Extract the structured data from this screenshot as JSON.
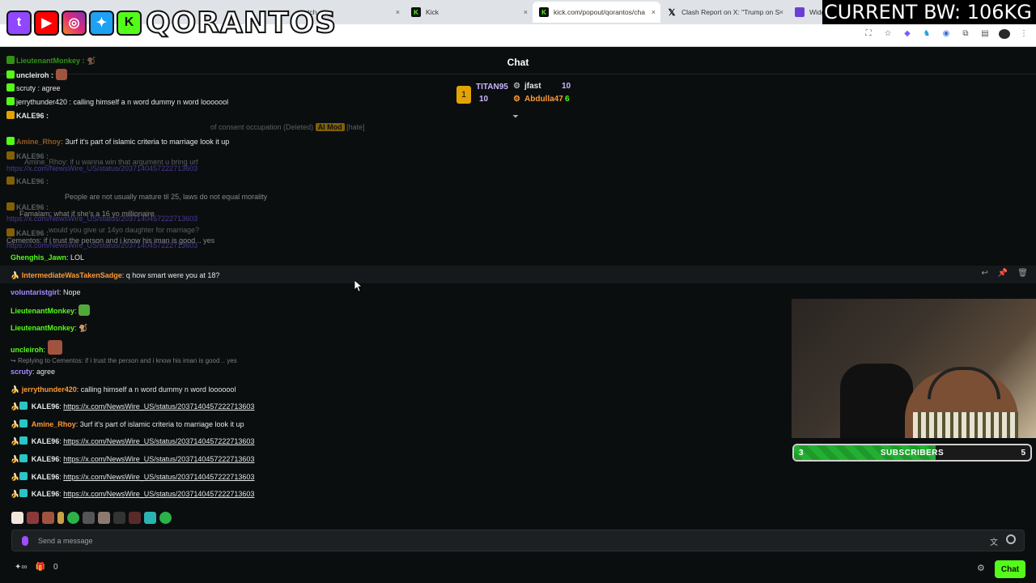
{
  "browser": {
    "tabs": [
      {
        "label": "tch",
        "icon": "generic",
        "active": false
      },
      {
        "label": "Kick",
        "icon": "kick",
        "active": false
      },
      {
        "label": "kick.com/popout/qorantos/cha",
        "icon": "kick",
        "active": true
      },
      {
        "label": "Clash Report on X: \"Trump on S",
        "icon": "x",
        "active": false
      },
      {
        "label": "Widg",
        "icon": "generic",
        "active": false
      }
    ],
    "close_glyph": "×"
  },
  "overlay": {
    "logo_text": "QORANTOS",
    "socials": [
      "twitch",
      "youtube",
      "instagram",
      "twitter",
      "kick"
    ],
    "bodyweight": "CURRENT BW: 106KG"
  },
  "chat": {
    "title": "Chat",
    "leaderboard": [
      {
        "name": "TITAN95",
        "count": "10",
        "color": "#c9b8ff"
      },
      {
        "name": "jfast",
        "count": "10",
        "color": "#e6e6e6"
      },
      {
        "name": "Abdulla47",
        "count": "6",
        "color": "#ff9933"
      }
    ],
    "ghost_messages": [
      {
        "text": "LieutenantMonkey :",
        "user_color": "#53fc18"
      },
      {
        "text": "uncleiroh :",
        "user_color": "#e6e6e6"
      },
      {
        "text": "scruty : agree",
        "user_color": "#a58aff"
      },
      {
        "text": "jerrythunder420 : calling himself a n word dummy n word looooool",
        "user_color": "#53fc18"
      },
      {
        "text": "KALE96 :",
        "user_color": "#e6e6e6"
      },
      {
        "text": "of consent occupation (Deleted)",
        "badge": "AI Mod",
        "suffix": "[hate]"
      },
      {
        "text": "3urf it's part of islamic criteria to marriage look it up",
        "user": "Amine_Rhoy"
      },
      {
        "text": "KALE96 :",
        "user_color": "#e6e6e6"
      },
      {
        "text": "Amine_Rhoy: if u wanna win that argument u bring urf"
      },
      {
        "text": "https://x.com/NewsWire_US/status/2037140457222713603"
      },
      {
        "text": "KALE96 :"
      },
      {
        "text": "People are not usually mature til 25, laws do not equal morality"
      },
      {
        "text": "KALE96 :"
      },
      {
        "text": "https://x.com/NewsWire_US/status/2037140457222713603"
      },
      {
        "text": "Famalam: what if she's a 16 yo millionaire"
      },
      {
        "text": "would you give ur 14yo daughter for marriage?"
      },
      {
        "text": "KALE96 :"
      },
      {
        "text": "Cementos: if i trust the person and i know his iman is good .. yes"
      },
      {
        "text": "https://x.com/NewsWire_US/status/2037140457222713603"
      }
    ],
    "messages": [
      {
        "user": "Ghenghis_Jawn",
        "user_color": "#53fc18",
        "text": "LOL"
      },
      {
        "user": "IntermediateWasTakenSadge",
        "user_color": "#ff9933",
        "text": "q how smart were you at 18?",
        "badge": "banana"
      },
      {
        "user": "voluntaristgirl",
        "user_color": "#a58aff",
        "text": "Nope"
      },
      {
        "user": "LieutenantMonkey",
        "user_color": "#53fc18",
        "text": "",
        "emote": "pepe"
      },
      {
        "user": "LieutenantMonkey",
        "user_color": "#53fc18",
        "text": "",
        "emote": "monkey"
      },
      {
        "user": "uncleiroh",
        "user_color": "#53fc18",
        "text": "",
        "emote": "face"
      },
      {
        "reply": "Replying to Cementos: if i trust the person and i know his iman is good .. yes"
      },
      {
        "user": "scruty",
        "user_color": "#a58aff",
        "text": "agree"
      },
      {
        "user": "jerrythunder420",
        "user_color": "#ff9933",
        "text": "calling himself a n word dummy n word looooool",
        "badge": "banana"
      },
      {
        "user": "KALE96",
        "user_color": "#e6e6e6",
        "text": "https://x.com/NewsWire_US/status/2037140457222713603",
        "badge": "banana",
        "link": true
      },
      {
        "user": "Amine_Rhoy",
        "user_color": "#ff9933",
        "text": "3urf it's part of islamic criteria to marriage look it up",
        "badge": "banana"
      },
      {
        "user": "KALE96",
        "user_color": "#e6e6e6",
        "text": "https://x.com/NewsWire_US/status/2037140457222713603",
        "badge": "banana",
        "link": true
      },
      {
        "user": "KALE96",
        "user_color": "#e6e6e6",
        "text": "https://x.com/NewsWire_US/status/2037140457222713603",
        "badge": "banana",
        "link": true
      },
      {
        "user": "KALE96",
        "user_color": "#e6e6e6",
        "text": "https://x.com/NewsWire_US/status/2037140457222713603",
        "badge": "banana",
        "link": true
      },
      {
        "user": "KALE96",
        "user_color": "#e6e6e6",
        "text": "https://x.com/NewsWire_US/status/2037140457222713603",
        "badge": "banana",
        "link": true
      }
    ],
    "input_placeholder": "Send a message",
    "footer_count": "0",
    "chat_button": "Chat"
  },
  "webcam": {
    "subs_label": "SUBSCRIBERS",
    "subs_current": "3",
    "subs_goal": "5",
    "subs_progress": 0.6
  },
  "colors": {
    "kick_green": "#53fc18",
    "background": "#0b0e0f",
    "gold": "#e2a400"
  }
}
